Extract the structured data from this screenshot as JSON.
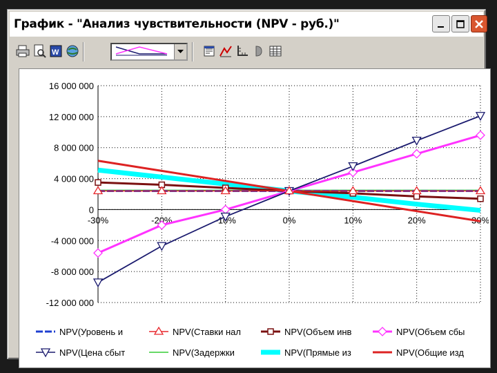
{
  "window": {
    "title": "График - \"Анализ чувствительности (NPV - руб.)\""
  },
  "toolbar": {
    "tools": [
      "print-icon",
      "print-preview-icon",
      "word-export-icon",
      "web-export-icon"
    ],
    "tools2": [
      "chart-properties-icon",
      "series-icon",
      "axis-icon",
      "format-icon",
      "table-icon"
    ]
  },
  "chart_data": {
    "type": "line",
    "x": [
      "-30%",
      "-20%",
      "-10%",
      "0%",
      "10%",
      "20%",
      "30%"
    ],
    "y_ticks": [
      "16 000 000",
      "12 000 000",
      "8 000 000",
      "4 000 000",
      "0",
      "-4 000 000",
      "-8 000 000",
      "-12 000 000"
    ],
    "ylim": [
      -12000000,
      16000000
    ],
    "grid": true,
    "legend_position": "bottom",
    "series": [
      {
        "name": "NPV(Уровень и",
        "color": "#1f3fd0",
        "marker": "none",
        "dash": true,
        "values": [
          2400000,
          2400000,
          2400000,
          2400000,
          2400000,
          2400000,
          2400000
        ]
      },
      {
        "name": "NPV(Ставки нал",
        "color": "#e8262b",
        "marker": "triangle-up",
        "values": [
          2400000,
          2400000,
          2400000,
          2400000,
          2400000,
          2400000,
          2400000
        ]
      },
      {
        "name": "NPV(Объем инв",
        "color": "#7a1010",
        "marker": "square",
        "values": [
          3500000,
          3200000,
          2800000,
          2400000,
          2100000,
          1700000,
          1400000
        ]
      },
      {
        "name": "NPV(Объем сбы",
        "color": "#ff33ff",
        "marker": "diamond",
        "values": [
          -5600000,
          -2000000,
          0,
          2400000,
          4800000,
          7200000,
          9600000
        ]
      },
      {
        "name": "NPV(Цена сбыт",
        "color": "#1a1a6e",
        "marker": "triangle-down",
        "values": [
          -9400000,
          -4700000,
          -900000,
          2400000,
          5600000,
          8900000,
          12100000
        ]
      },
      {
        "name": "NPV(Задержки",
        "color": "#33cc33",
        "marker": "none",
        "values": [
          2500000,
          2500000,
          2500000,
          2500000,
          2500000,
          2500000,
          2500000
        ]
      },
      {
        "name": "NPV(Прямые из",
        "color": "#00ffff",
        "marker": "none",
        "values": [
          5100000,
          4200000,
          3300000,
          2400000,
          1600000,
          700000,
          -100000
        ]
      },
      {
        "name": "NPV(Общие изд",
        "color": "#dd2222",
        "marker": "none",
        "values": [
          6300000,
          5000000,
          3700000,
          2400000,
          1100000,
          -200000,
          -1500000
        ]
      }
    ]
  },
  "colors": {
    "title_bg": "#ffffff",
    "window_bg": "#d4d0c8",
    "close_button": "#d9562f"
  }
}
